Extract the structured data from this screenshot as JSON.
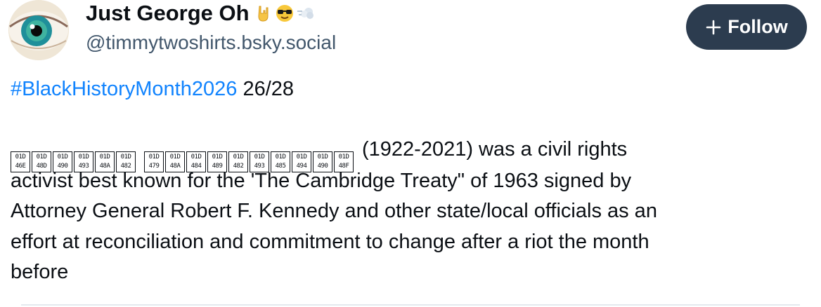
{
  "author": {
    "display_name": "Just George Oh",
    "emoji_icons": [
      "rock-on-hand-icon",
      "sunglasses-face-icon",
      "dash-cloud-icon"
    ],
    "handle": "@timmytwoshirts.bsky.social"
  },
  "follow_button": {
    "label": "Follow",
    "icon": "plus-icon"
  },
  "post": {
    "hashtag": "#BlackHistoryMonth2026",
    "counter": "26/28",
    "missing_glyph_word_1": [
      [
        "01D",
        "46E"
      ],
      [
        "01D",
        "48D"
      ],
      [
        "01D",
        "490"
      ],
      [
        "01D",
        "493"
      ],
      [
        "01D",
        "48A"
      ],
      [
        "01D",
        "482"
      ]
    ],
    "missing_glyph_word_2": [
      [
        "01D",
        "479"
      ],
      [
        "01D",
        "48A"
      ],
      [
        "01D",
        "484"
      ],
      [
        "01D",
        "489"
      ],
      [
        "01D",
        "482"
      ],
      [
        "01D",
        "493"
      ],
      [
        "01D",
        "485"
      ],
      [
        "01D",
        "494"
      ],
      [
        "01D",
        "490"
      ],
      [
        "01D",
        "48F"
      ]
    ],
    "line_1_text": "(1922-2021) was a civil rights",
    "line_2_text": "activist best known for the 'The Cambridge Treaty\" of 1963 signed by",
    "line_3_text": "Attorney General Robert F. Kennedy and other state/local officials as an",
    "line_4_text": "effort at reconciliation and commitment to change after a riot the month",
    "line_5_text": "before"
  },
  "colors": {
    "hashtag": "#1083fe",
    "follow_button_bg": "#2c3c4f",
    "handle": "#42576c",
    "text": "#0b0f14"
  }
}
